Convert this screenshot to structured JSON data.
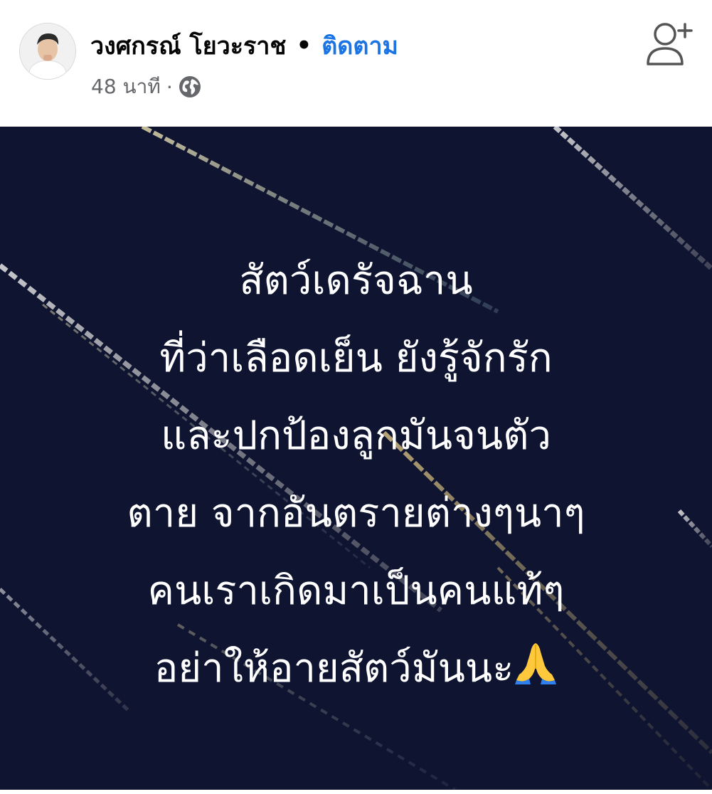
{
  "post": {
    "author_name": "วงศกรณ์ โยวะราช",
    "separator": "•",
    "follow_label": "ติดตาม",
    "timestamp": "48 นาที",
    "meta_separator": "·",
    "audience_icon": "globe-icon",
    "action_icon": "add-friend-icon",
    "avatar_icon": "profile-photo"
  },
  "image_text": {
    "lines": [
      "สัตว์เดรัจฉาน",
      "ที่ว่าเลือดเย็น ยังรู้จักรัก",
      "และปกป้องลูกมันจนตัว",
      "ตาย จากอันตรายต่างๆนาๆ",
      "คนเราเกิดมาเป็นคนแท้ๆ",
      "อย่าให้อายสัตว์มันนะ"
    ],
    "emoji": "folded-hands"
  },
  "colors": {
    "follow": "#1b74e4",
    "image_background": "#0f1431",
    "meta_text": "#65676b"
  }
}
